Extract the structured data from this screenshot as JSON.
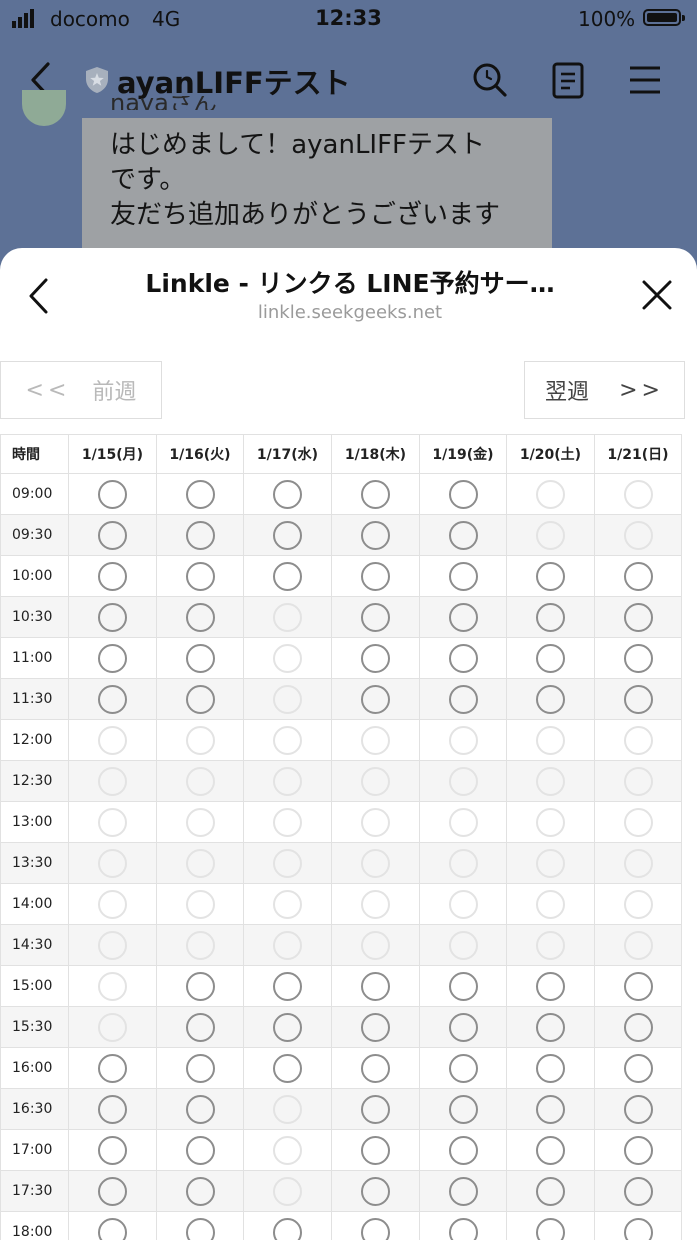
{
  "status_bar": {
    "carrier": "docomo",
    "network": "4G",
    "time": "12:33",
    "battery": "100%"
  },
  "chat": {
    "title": "ayanLIFFテスト",
    "sender_fragment": "nayaさん",
    "message_lines": [
      "はじめまして！ayanLIFFテスト",
      "です。",
      "友だち追加ありがとうございます"
    ]
  },
  "sheet": {
    "title": "Linkle - リンクる LINE予約サー…",
    "domain": "linkle.seekgeeks.net"
  },
  "nav": {
    "prev_arrows": "<<",
    "prev_label": "前週",
    "next_label": "翌週",
    "next_arrows": ">>"
  },
  "schedule": {
    "time_header": "時間",
    "days": [
      "1/15(月)",
      "1/16(火)",
      "1/17(水)",
      "1/18(木)",
      "1/19(金)",
      "1/20(土)",
      "1/21(日)"
    ],
    "slots": [
      {
        "time": "09:00",
        "available": [
          true,
          true,
          true,
          true,
          true,
          false,
          false
        ]
      },
      {
        "time": "09:30",
        "available": [
          true,
          true,
          true,
          true,
          true,
          false,
          false
        ]
      },
      {
        "time": "10:00",
        "available": [
          true,
          true,
          true,
          true,
          true,
          true,
          true
        ]
      },
      {
        "time": "10:30",
        "available": [
          true,
          true,
          false,
          true,
          true,
          true,
          true
        ]
      },
      {
        "time": "11:00",
        "available": [
          true,
          true,
          false,
          true,
          true,
          true,
          true
        ]
      },
      {
        "time": "11:30",
        "available": [
          true,
          true,
          false,
          true,
          true,
          true,
          true
        ]
      },
      {
        "time": "12:00",
        "available": [
          false,
          false,
          false,
          false,
          false,
          false,
          false
        ]
      },
      {
        "time": "12:30",
        "available": [
          false,
          false,
          false,
          false,
          false,
          false,
          false
        ]
      },
      {
        "time": "13:00",
        "available": [
          false,
          false,
          false,
          false,
          false,
          false,
          false
        ]
      },
      {
        "time": "13:30",
        "available": [
          false,
          false,
          false,
          false,
          false,
          false,
          false
        ]
      },
      {
        "time": "14:00",
        "available": [
          false,
          false,
          false,
          false,
          false,
          false,
          false
        ]
      },
      {
        "time": "14:30",
        "available": [
          false,
          false,
          false,
          false,
          false,
          false,
          false
        ]
      },
      {
        "time": "15:00",
        "available": [
          false,
          true,
          true,
          true,
          true,
          true,
          true
        ]
      },
      {
        "time": "15:30",
        "available": [
          false,
          true,
          true,
          true,
          true,
          true,
          true
        ]
      },
      {
        "time": "16:00",
        "available": [
          true,
          true,
          true,
          true,
          true,
          true,
          true
        ]
      },
      {
        "time": "16:30",
        "available": [
          true,
          true,
          false,
          true,
          true,
          true,
          true
        ]
      },
      {
        "time": "17:00",
        "available": [
          true,
          true,
          false,
          true,
          true,
          true,
          true
        ]
      },
      {
        "time": "17:30",
        "available": [
          true,
          true,
          false,
          true,
          true,
          true,
          true
        ]
      },
      {
        "time": "18:00",
        "available": [
          true,
          true,
          true,
          true,
          true,
          true,
          true
        ]
      }
    ]
  },
  "colors": {
    "chat_background": "#5d7196",
    "slot_available": "#8d8d8d",
    "slot_unavailable": "#e3e3e3",
    "grid_line": "#e1e1e1"
  }
}
